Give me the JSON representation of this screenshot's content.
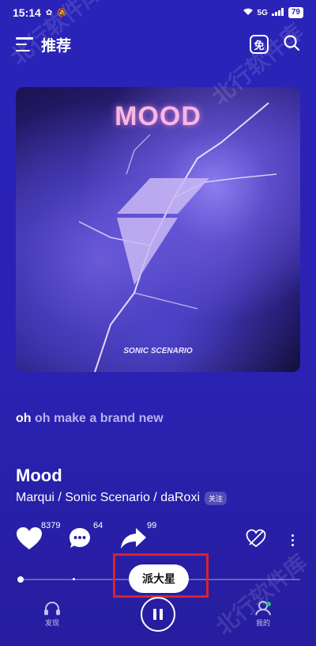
{
  "status_bar": {
    "time": "15:14",
    "battery": "79",
    "network": "5G"
  },
  "header": {
    "title": "推荐",
    "free_icon_label": "免"
  },
  "cover": {
    "title": "MOOD",
    "subtitle": "SONIC SCENARIO"
  },
  "lyric": {
    "highlight": "oh",
    "rest": " oh make a brand new"
  },
  "song": {
    "title": "Mood",
    "artists": "Marqui / Sonic Scenario / daRoxi",
    "follow_label": "关注"
  },
  "actions": {
    "likes": "8379",
    "comments": "64",
    "shares": "99"
  },
  "player": {
    "progress": 0.01
  },
  "toast": {
    "text": "派大星"
  },
  "nav": {
    "discover": "发现",
    "mine": "我的"
  },
  "watermark": {
    "text": "北行软件库"
  },
  "colors": {
    "background": "#2a23b8",
    "accent_pink": "#f7b6e4",
    "highlight_box": "#d9232b",
    "online": "#26c281"
  }
}
